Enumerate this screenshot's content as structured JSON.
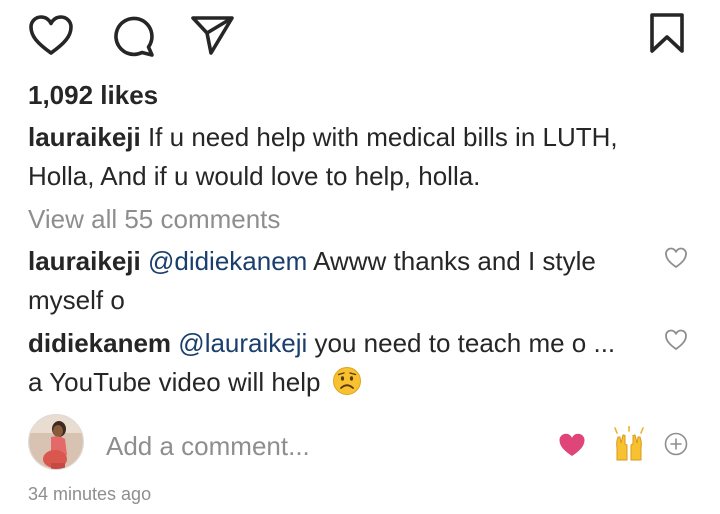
{
  "actions": {
    "like_icon": "heart-outline-icon",
    "comment_icon": "comment-bubble-icon",
    "share_icon": "paper-plane-icon",
    "save_icon": "bookmark-outline-icon"
  },
  "post": {
    "likes": "1,092 likes",
    "caption_user": "lauraikeji",
    "caption_text": " If u need help with medical bills in LUTH, Holla, And if u would love to help, holla.",
    "view_all_comments": "View all 55 comments",
    "timestamp": "34 minutes ago"
  },
  "comments": [
    {
      "user": "lauraikeji",
      "mention": "@didiekanem",
      "text": " Awww thanks and I style myself o",
      "emoji": ""
    },
    {
      "user": "didiekanem",
      "mention": "@lauraikeji",
      "text": " you need to teach me o ... a YouTube video will help",
      "emoji": "disappointed-face-emoji"
    }
  ],
  "composer": {
    "placeholder": "Add a comment...",
    "quick_reactions": [
      "red-heart-emoji",
      "raised-hands-emoji",
      "add-circle-icon"
    ]
  },
  "colors": {
    "text": "#262626",
    "secondary": "#8e8e8e",
    "mention": "#1b3f6d",
    "heart": "#e0457a"
  }
}
